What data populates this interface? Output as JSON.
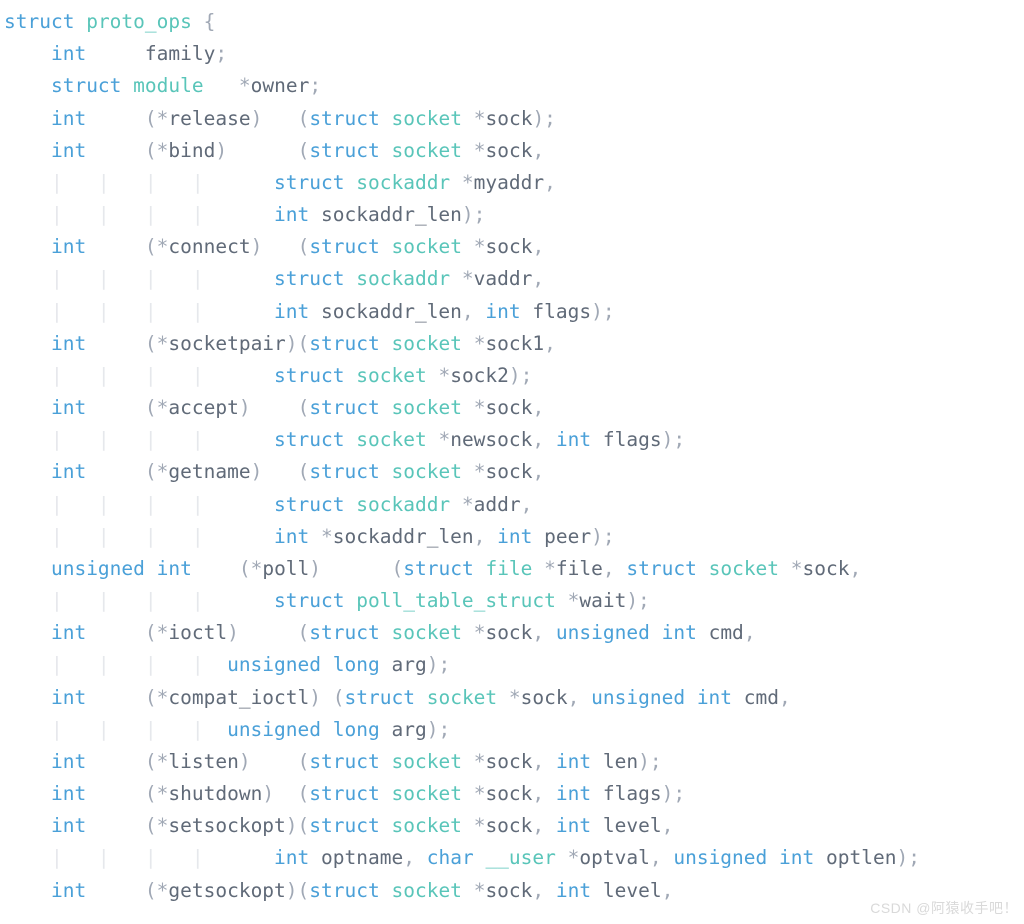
{
  "watermark": "CSDN @阿猿收手吧！",
  "code": {
    "kw_struct": "struct",
    "kw_int": "int",
    "kw_unsigned": "unsigned",
    "kw_long": "long",
    "kw_char": "char",
    "ty_proto_ops": "proto_ops",
    "ty_module": "module",
    "ty_socket": "socket",
    "ty_sockaddr": "sockaddr",
    "ty_file": "file",
    "ty_poll_table_struct": "poll_table_struct",
    "ty_user": "__user",
    "id_family": "family",
    "id_owner": "owner",
    "id_release": "release",
    "id_bind": "bind",
    "id_connect": "connect",
    "id_socketpair": "socketpair",
    "id_accept": "accept",
    "id_getname": "getname",
    "id_poll": "poll",
    "id_ioctl": "ioctl",
    "id_compat_ioctl": "compat_ioctl",
    "id_listen": "listen",
    "id_shutdown": "shutdown",
    "id_setsockopt": "setsockopt",
    "id_getsockopt": "getsockopt",
    "id_sock": "sock",
    "id_sock1": "sock1",
    "id_sock2": "sock2",
    "id_newsock": "newsock",
    "id_myaddr": "myaddr",
    "id_vaddr": "vaddr",
    "id_addr": "addr",
    "id_sockaddr_len": "sockaddr_len",
    "id_flags": "flags",
    "id_peer": "peer",
    "id_file": "file",
    "id_wait": "wait",
    "id_cmd": "cmd",
    "id_arg": "arg",
    "id_len": "len",
    "id_level": "level",
    "id_optname": "optname",
    "id_optval": "optval",
    "id_optlen": "optlen"
  }
}
